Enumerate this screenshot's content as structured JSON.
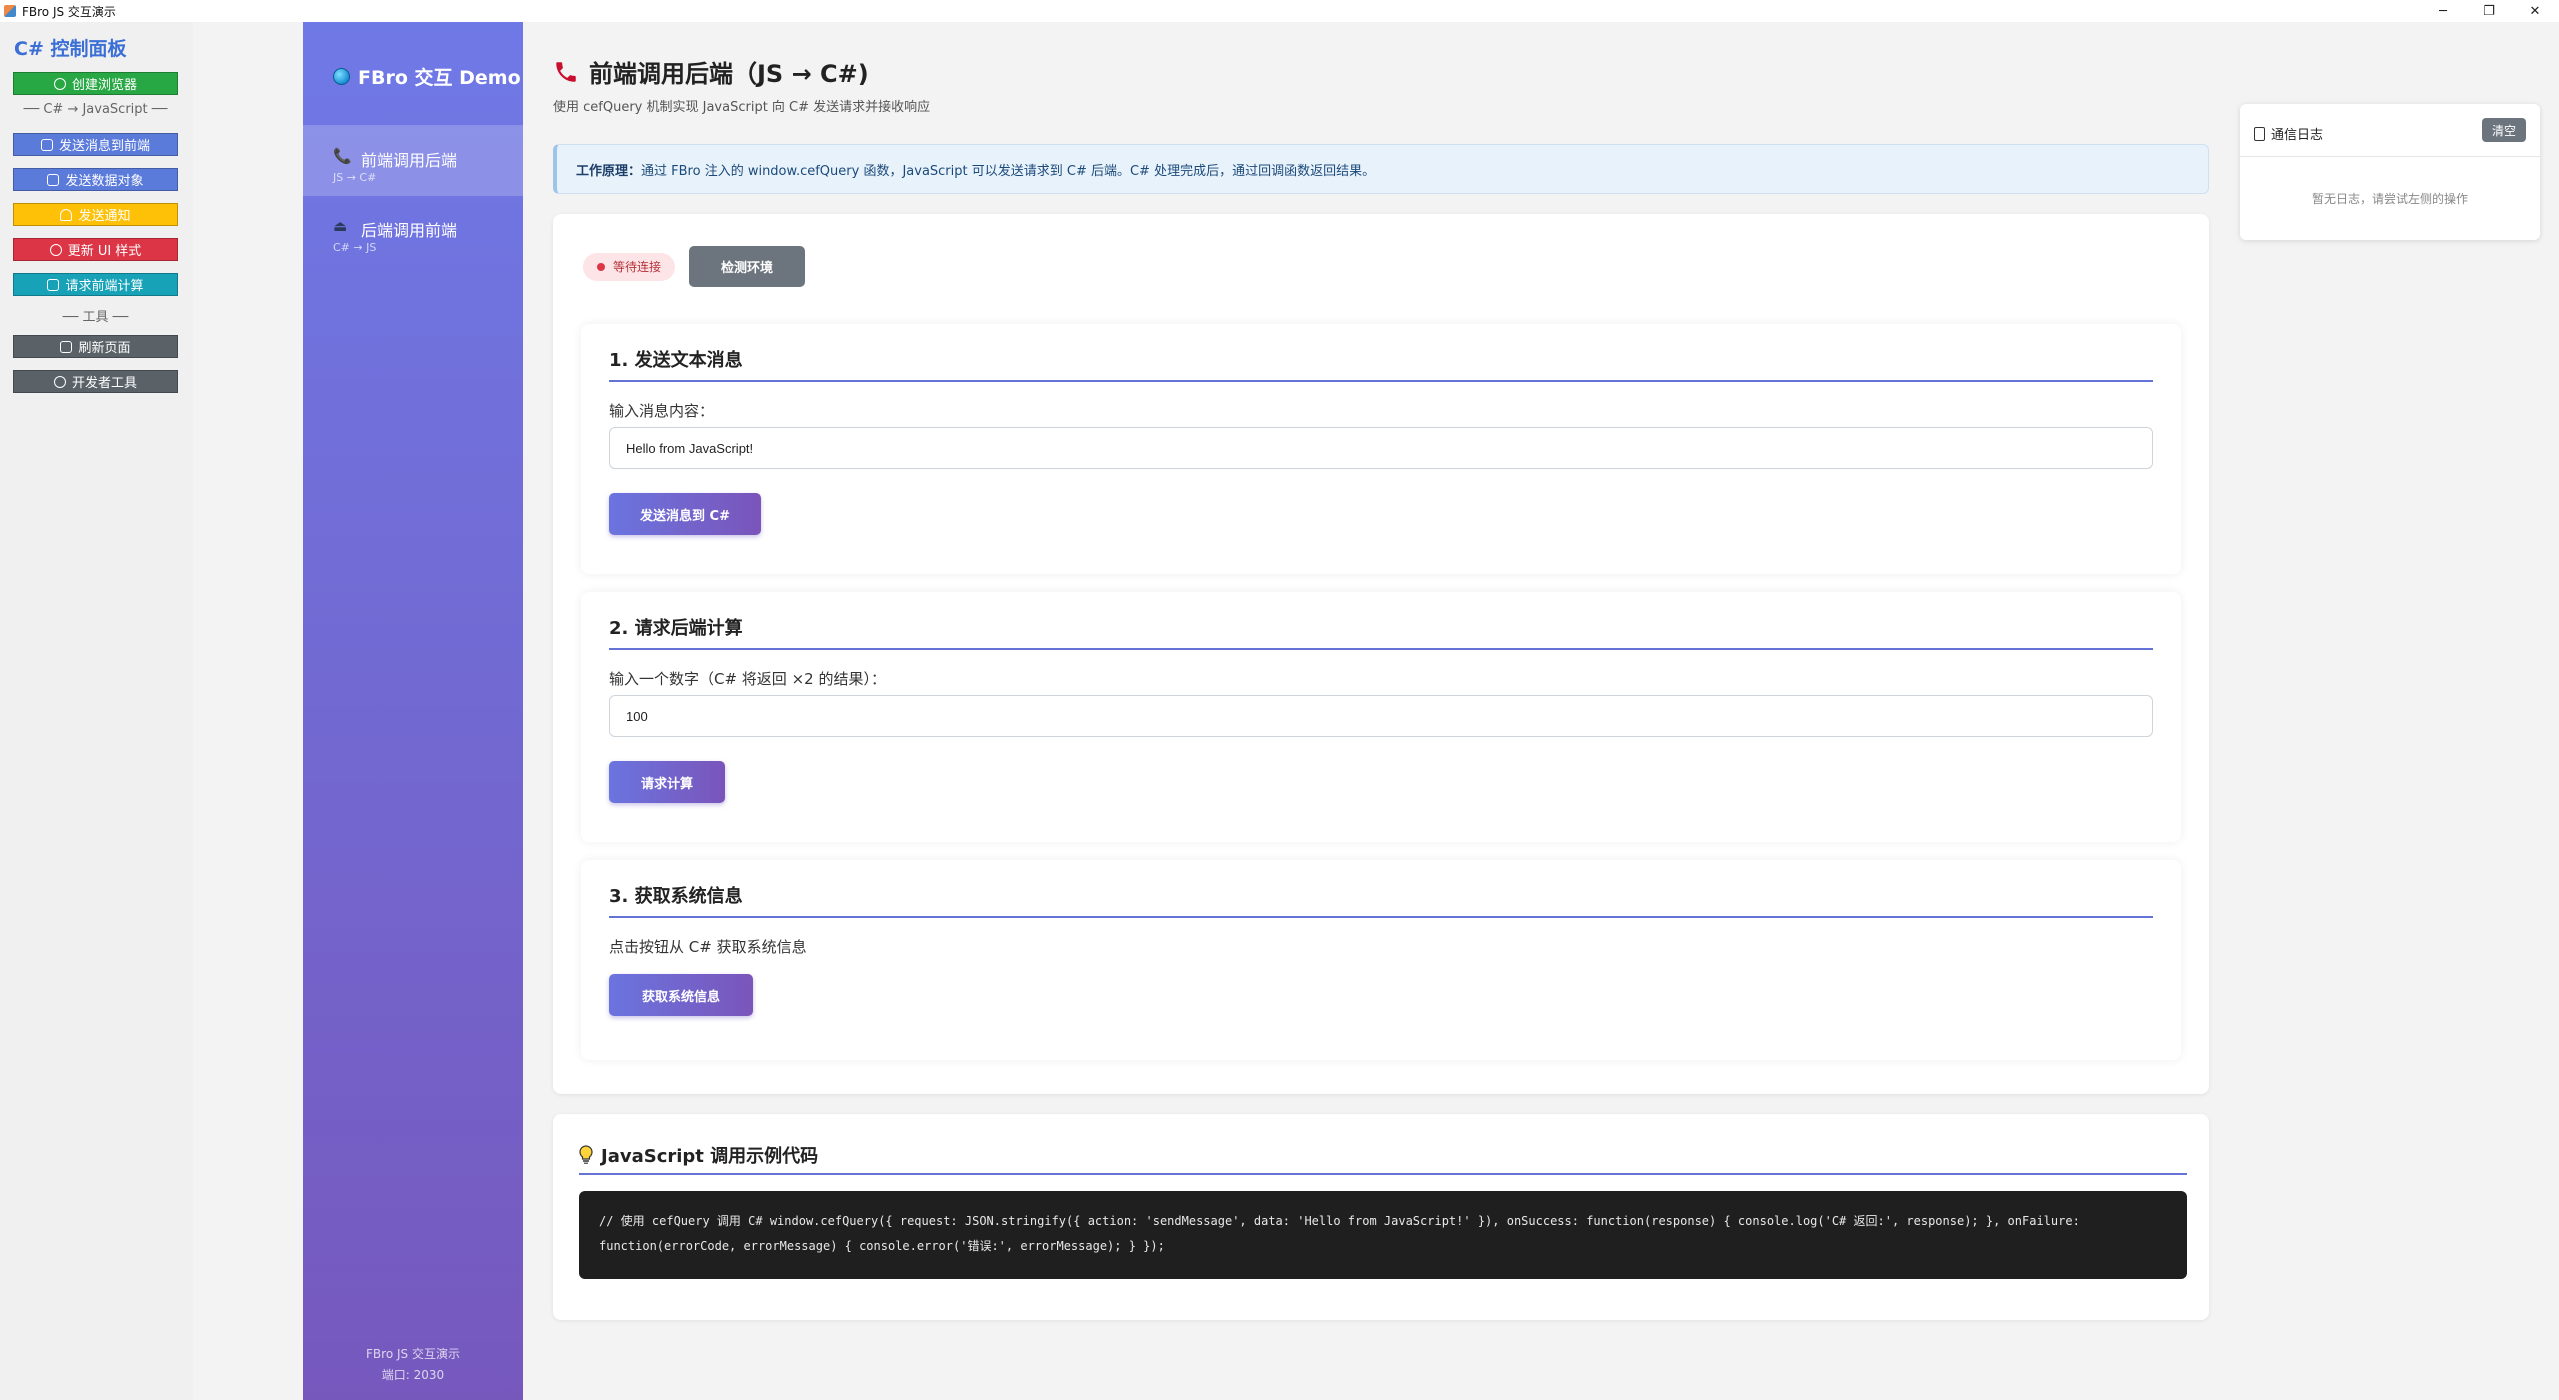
{
  "window": {
    "title": "FBro JS 交互演示",
    "minimize": "─",
    "restore": "❐",
    "close": "✕"
  },
  "cs_panel": {
    "title": "C# 控制面板",
    "create_browser": "创建浏览器",
    "sep_js": "── C# → JavaScript ──",
    "send_msg": "发送消息到前端",
    "send_obj": "发送数据对象",
    "send_notify": "发送通知",
    "update_ui": "更新 UI 样式",
    "request_calc": "请求前端计算",
    "sep_tools": "── 工具 ──",
    "refresh": "刷新页面",
    "devtools": "开发者工具",
    "colors": {
      "green": "#28a745",
      "blue": "#5b7bdb",
      "yellow": "#ffc107",
      "red": "#dc3545",
      "teal": "#17a2b8",
      "gray": "#5a6268"
    }
  },
  "nav": {
    "brand": "FBro 交互 Demo",
    "items": [
      {
        "label": "前端调用后端",
        "sub": "JS → C#",
        "icon": "phone-icon"
      },
      {
        "label": "后端调用前端",
        "sub": "C# → JS",
        "icon": "upload-icon"
      }
    ],
    "footer_line1": "FBro JS 交互演示",
    "footer_line2": "端口: 2030"
  },
  "main": {
    "title": "前端调用后端（JS → C#)",
    "subtitle": "使用 cefQuery 机制实现 JavaScript 向 C# 发送请求并接收响应",
    "info_label": "工作原理：",
    "info_text": "通过 FBro 注入的 window.cefQuery 函数，JavaScript 可以发送请求到 C# 后端。C# 处理完成后，通过回调函数返回结果。",
    "status_badge": "等待连接",
    "check_env": "检测环境",
    "sections": [
      {
        "heading": "1. 发送文本消息",
        "label": "输入消息内容：",
        "value": "Hello from JavaScript!",
        "button": "发送消息到 C#"
      },
      {
        "heading": "2. 请求后端计算",
        "label": "输入一个数字（C# 将返回 ×2 的结果）：",
        "value": "100",
        "button": "请求计算"
      },
      {
        "heading": "3. 获取系统信息",
        "label": "点击按钮从 C# 获取系统信息",
        "button": "获取系统信息"
      }
    ],
    "code_heading": "JavaScript 调用示例代码",
    "code": "// 使用 cefQuery 调用 C# window.cefQuery({ request: JSON.stringify({ action: 'sendMessage', data: 'Hello from JavaScript!' }), onSuccess: function(response) { console.log('C# 返回:', response); }, onFailure: function(errorCode, errorMessage) { console.error('错误:', errorMessage); } });"
  },
  "log": {
    "title": "通信日志",
    "clear": "清空",
    "empty": "暂无日志，请尝试左侧的操作"
  }
}
